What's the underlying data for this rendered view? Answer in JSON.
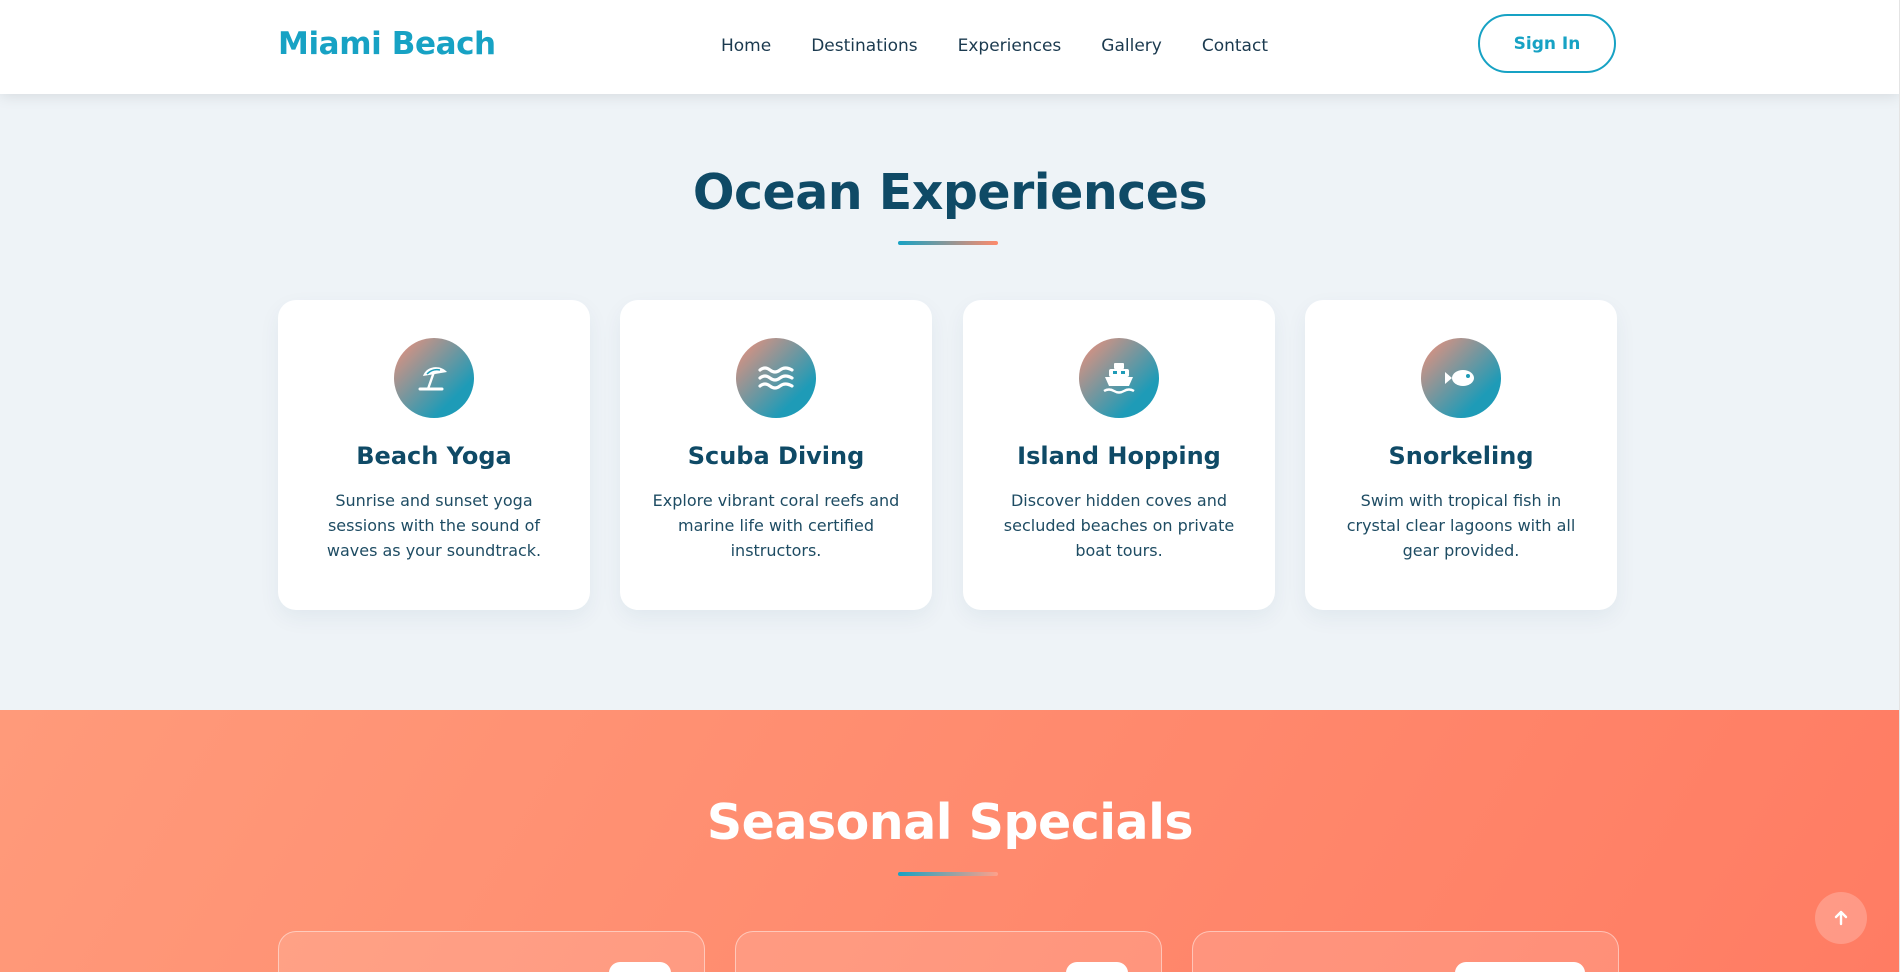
{
  "header": {
    "logo": "Miami Beach",
    "nav": [
      "Home",
      "Destinations",
      "Experiences",
      "Gallery",
      "Contact"
    ],
    "signin_label": "Sign In"
  },
  "experiences": {
    "title": "Ocean Experiences",
    "cards": [
      {
        "icon": "beach-umbrella-icon",
        "title": "Beach Yoga",
        "description": "Sunrise and sunset yoga sessions with the sound of waves as your soundtrack."
      },
      {
        "icon": "water-waves-icon",
        "title": "Scuba Diving",
        "description": "Explore vibrant coral reefs and marine life with certified instructors."
      },
      {
        "icon": "ship-icon",
        "title": "Island Hopping",
        "description": "Discover hidden coves and secluded beaches on private boat tours."
      },
      {
        "icon": "fish-icon",
        "title": "Snorkeling",
        "description": "Swim with tropical fish in crystal clear lagoons with all gear provided."
      }
    ]
  },
  "seasonal": {
    "title": "Seasonal Specials"
  },
  "colors": {
    "brand": "#17a2c4",
    "heading": "#0f4a66",
    "coral": "#ff8a6b",
    "background": "#eef3f7"
  }
}
